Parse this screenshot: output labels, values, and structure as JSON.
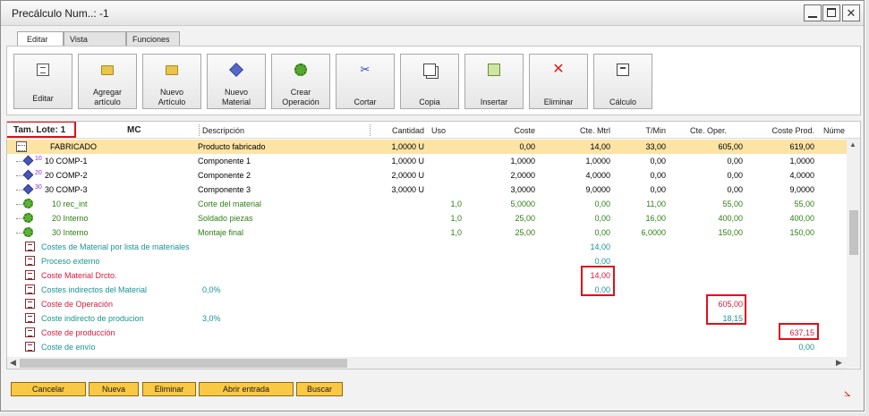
{
  "window": {
    "title": "Precálculo Num..: -1"
  },
  "tabs": [
    {
      "label": "Editar"
    },
    {
      "label": "Vista"
    },
    {
      "label": "Funciones"
    }
  ],
  "toolbar": [
    {
      "label": "Editar",
      "icon": "edit-icon"
    },
    {
      "label": "Agregar\nartículo",
      "icon": "folder-icon"
    },
    {
      "label": "Nuevo\nArtículo\nFabricado",
      "icon": "folder-icon"
    },
    {
      "label": "Nuevo\nMaterial",
      "icon": "cube-icon"
    },
    {
      "label": "Crear\nOperación",
      "icon": "gear-icon"
    },
    {
      "label": "Cortar",
      "icon": "scissors-icon"
    },
    {
      "label": "Copia",
      "icon": "copy-icon"
    },
    {
      "label": "Insertar",
      "icon": "insert-icon"
    },
    {
      "label": "Eliminar",
      "icon": "delete-x-icon"
    },
    {
      "label": "Cálculo",
      "icon": "calculator-icon"
    }
  ],
  "grid": {
    "lot_label": "Tam. Lote: 1",
    "columns": {
      "mc": "MC",
      "descripcion": "Descripción",
      "cantidad": "Cantidad",
      "uso": "Uso",
      "coste": "Coste",
      "cte_mtrl": "Cte. Mtrl",
      "tmin": "T/Min",
      "cte_oper": "Cte. Oper.",
      "coste_prod": "Coste Prod.",
      "numero": "Núme"
    },
    "rows": [
      {
        "name": "FABRICADO",
        "desc": "Producto fabricado",
        "cantidad": "1,0000 U",
        "uso": "",
        "coste": "0,00",
        "cte_mtrl": "14,00",
        "tmin": "33,00",
        "cte_oper": "605,00",
        "coste_prod": "619,00"
      },
      {
        "pos": "10",
        "code": "10  COMP-1",
        "desc": "Componente 1",
        "cantidad": "1,0000 U",
        "uso": "",
        "coste": "1,0000",
        "cte_mtrl": "1,0000",
        "tmin": "0,00",
        "cte_oper": "0,00",
        "coste_prod": "1,0000"
      },
      {
        "pos": "20",
        "code": "20  COMP-2",
        "desc": "Componente 2",
        "cantidad": "2,0000 U",
        "uso": "",
        "coste": "2,0000",
        "cte_mtrl": "4,0000",
        "tmin": "0,00",
        "cte_oper": "0,00",
        "coste_prod": "4,0000"
      },
      {
        "pos": "30",
        "code": "30  COMP-3",
        "desc": "Componente 3",
        "cantidad": "3,0000 U",
        "uso": "",
        "coste": "3,0000",
        "cte_mtrl": "9,0000",
        "tmin": "0,00",
        "cte_oper": "0,00",
        "coste_prod": "9,0000"
      },
      {
        "code": "10  rec_int",
        "desc": "Corte del material",
        "uso": "1,0",
        "coste": "5,0000",
        "cte_mtrl": "0,00",
        "tmin": "11,00",
        "cte_oper": "55,00",
        "coste_prod": "55,00"
      },
      {
        "code": "20  Interno",
        "desc": "Soldado piezas",
        "uso": "1,0",
        "coste": "25,00",
        "cte_mtrl": "0,00",
        "tmin": "16,00",
        "cte_oper": "400,00",
        "coste_prod": "400,00"
      },
      {
        "code": "30  Interno",
        "desc": "Montaje final",
        "uso": "1,0",
        "coste": "25,00",
        "cte_mtrl": "0,00",
        "tmin": "6,0000",
        "cte_oper": "150,00",
        "coste_prod": "150,00"
      }
    ],
    "summary": [
      {
        "label": "Costes de Material por lista de materiales",
        "pct": "",
        "cte_mtrl": "14,00",
        "cte_oper": "",
        "coste_prod": ""
      },
      {
        "label": "Proceso externo",
        "pct": "",
        "cte_mtrl": "0,00",
        "cte_oper": "",
        "coste_prod": ""
      },
      {
        "label": "Coste Material Drcto.",
        "pct": "",
        "cte_mtrl": "14,00",
        "cte_oper": "",
        "coste_prod": ""
      },
      {
        "label": "Costes indirectos del Material",
        "pct": "0,0%",
        "cte_mtrl": "0,00",
        "cte_oper": "",
        "coste_prod": ""
      },
      {
        "label": "Coste de Operación",
        "pct": "",
        "cte_mtrl": "",
        "cte_oper": "605,00",
        "coste_prod": ""
      },
      {
        "label": "Coste indirecto de producion",
        "pct": "3,0%",
        "cte_mtrl": "",
        "cte_oper": "18,15",
        "coste_prod": ""
      },
      {
        "label": "Coste de producción",
        "pct": "",
        "cte_mtrl": "",
        "cte_oper": "",
        "coste_prod": "637,15"
      },
      {
        "label": "Coste de envío",
        "pct": "",
        "cte_mtrl": "",
        "cte_oper": "",
        "coste_prod": "0,00"
      }
    ]
  },
  "footer": [
    {
      "label": "Cancelar"
    },
    {
      "label": "Nueva"
    },
    {
      "label": "Eliminar"
    },
    {
      "label": "Abrir entrada"
    },
    {
      "label": "Buscar"
    }
  ],
  "colors": {
    "selected_row": "#fde3a4",
    "highlight_box": "#e0101a",
    "button_yellow": "#f9c845",
    "teal_text": "#1b9494",
    "green_text": "#2e7e13",
    "red_text": "#d9193b"
  }
}
